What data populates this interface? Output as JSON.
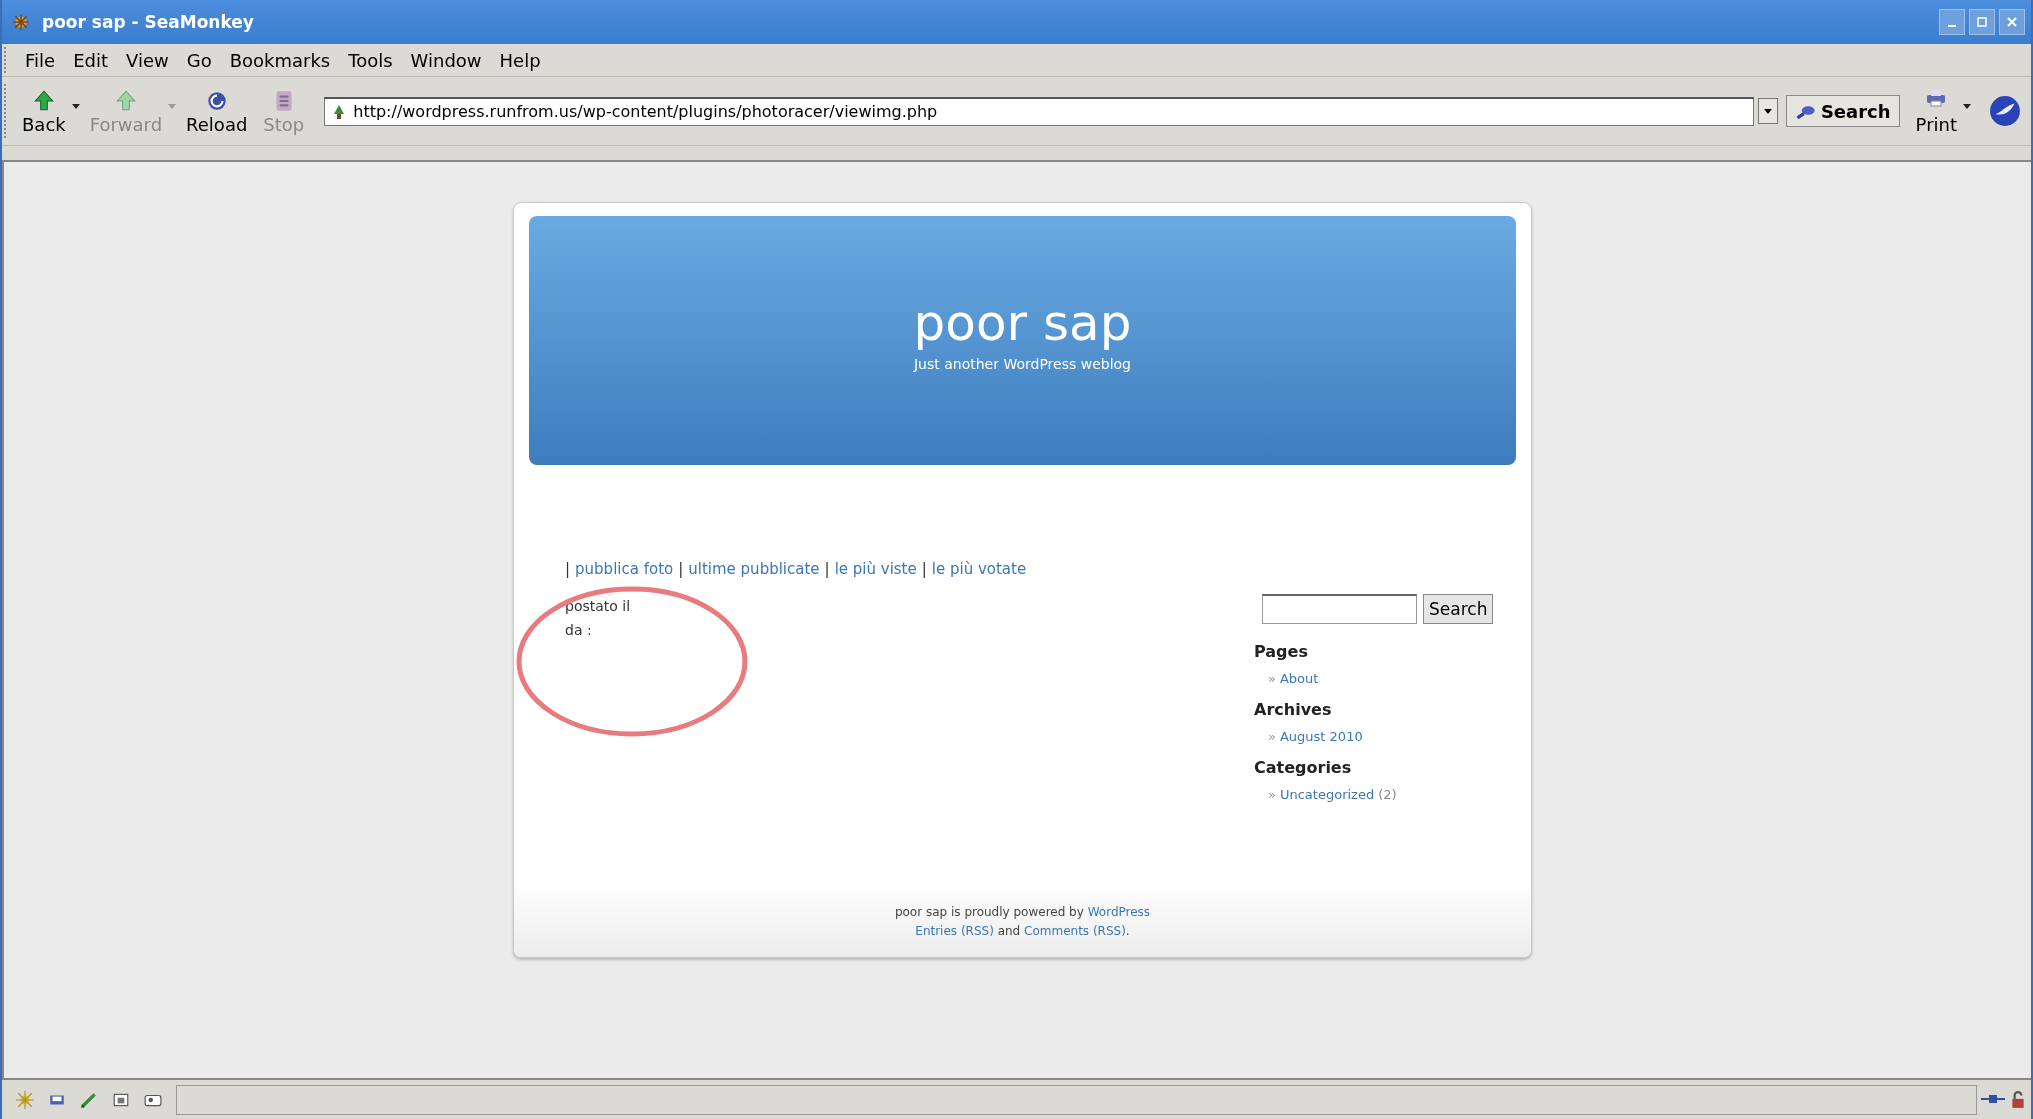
{
  "window": {
    "title": "poor sap - SeaMonkey"
  },
  "menu": [
    {
      "label": "File"
    },
    {
      "label": "Edit"
    },
    {
      "label": "View"
    },
    {
      "label": "Go"
    },
    {
      "label": "Bookmarks"
    },
    {
      "label": "Tools"
    },
    {
      "label": "Window"
    },
    {
      "label": "Help"
    }
  ],
  "toolbar": {
    "buttons": [
      {
        "kind": "back",
        "label": "Back",
        "disabled": false,
        "dropdown": true
      },
      {
        "kind": "forward",
        "label": "Forward",
        "disabled": true,
        "dropdown": true
      },
      {
        "kind": "reload",
        "label": "Reload",
        "disabled": false,
        "dropdown": false
      },
      {
        "kind": "stop",
        "label": "Stop",
        "disabled": true,
        "dropdown": false
      }
    ],
    "address": {
      "value": "http://wordpress.runfrom.us/wp-content/plugins/photoracer/viewimg.php"
    },
    "search_button": "Search",
    "print_button": "Print"
  },
  "page": {
    "blog_title": "poor sap",
    "tagline": "Just another WordPress weblog",
    "nav": [
      {
        "separator": "|",
        "label": "pubblica foto"
      },
      {
        "separator": "|",
        "label": "ultime pubblicate"
      },
      {
        "separator": "|",
        "label": "le più viste"
      },
      {
        "separator": "|",
        "label": "le più votate"
      }
    ],
    "post_lines": [
      "postato il",
      "da :"
    ],
    "annotation": {
      "kind": "ellipse",
      "color": "#e97a7e"
    },
    "sidebar": {
      "search_button": "Search",
      "widgets": [
        {
          "heading": "Pages",
          "items": [
            {
              "bullet": "»",
              "label": "About"
            }
          ]
        },
        {
          "heading": "Archives",
          "items": [
            {
              "bullet": "»",
              "label": "August 2010"
            }
          ]
        },
        {
          "heading": "Categories",
          "items": [
            {
              "bullet": "»",
              "label": "Uncategorized",
              "count": "(2)"
            }
          ]
        }
      ]
    },
    "footer": {
      "line_1": {
        "text": "poor sap is proudly powered by",
        "link": "WordPress"
      },
      "line_2": {
        "link_1": "Entries (RSS)",
        "joiner": "and",
        "link_2": "Comments (RSS)",
        "end": "."
      }
    }
  }
}
